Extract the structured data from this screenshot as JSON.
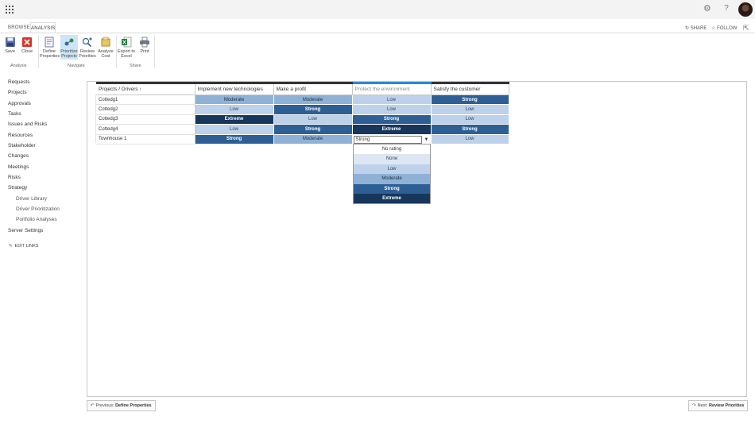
{
  "ribbon": {
    "tabs": {
      "browse": "BROWSE",
      "analysis": "ANALYSIS"
    },
    "actions": {
      "share": "SHARE",
      "follow": "FOLLOW"
    },
    "buttons": {
      "save": "Save",
      "close": "Close",
      "define_properties": [
        "Define",
        "Properties"
      ],
      "prioritize_projects": [
        "Prioritize",
        "Projects"
      ],
      "review_priorities": [
        "Review",
        "Priorities"
      ],
      "analyze_cost": [
        "Analyze",
        "Cost"
      ],
      "export_to_excel": [
        "Export to",
        "Excel"
      ],
      "print": "Print"
    },
    "groups": {
      "analysis": "Analysis",
      "navigate": "Navigate",
      "share": "Share"
    }
  },
  "nav": {
    "items": [
      "Requests",
      "Projects",
      "Approvals",
      "Tasks",
      "Issues and Risks",
      "Resources",
      "Stakeholder",
      "Changes",
      "Meetings",
      "Risks",
      "Strategy"
    ],
    "strategy_children": [
      "Driver Library",
      "Driver Prioritization",
      "Portfolio Analyses"
    ],
    "server_settings": "Server Settings",
    "edit_links": "EDIT LINKS"
  },
  "grid": {
    "headers": [
      "Projects / Drivers ↑",
      "Implement new technologies",
      "Make a profit",
      "Protect the environment",
      "Satisfy the customer"
    ],
    "rows": [
      {
        "project": "Cottedg1",
        "ratings": [
          "Moderate",
          "Moderate",
          "Low",
          "Strong"
        ]
      },
      {
        "project": "Cottedg2",
        "ratings": [
          "Low",
          "Strong",
          "Low",
          "Low"
        ]
      },
      {
        "project": "Cottedg3",
        "ratings": [
          "Extreme",
          "Low",
          "Strong",
          "Low"
        ]
      },
      {
        "project": "Cottedg4",
        "ratings": [
          "Low",
          "Strong",
          "Extreme",
          "Strong"
        ]
      },
      {
        "project": "Townhouse 1",
        "ratings": [
          "Strong",
          "Moderate",
          "Strong",
          "Low"
        ]
      }
    ],
    "editing_value": "Strong",
    "caret": "▼",
    "dropdown_options": [
      "No rating",
      "None",
      "Low",
      "Moderate",
      "Strong",
      "Extreme"
    ]
  },
  "footer": {
    "previous_prefix": "Previous:",
    "previous_target": "Define Properties",
    "next_prefix": "Next:",
    "next_target": "Review Priorities"
  },
  "colors": {
    "moderate": "#8fb1d6",
    "low": "#bed1ea",
    "strong": "#2d5f95",
    "extreme": "#17365c",
    "none": "#dde7f3",
    "accent": "#2b88d8"
  },
  "icons": [
    "app-launcher-icon",
    "gear-icon",
    "help-icon",
    "save-icon",
    "close-icon",
    "define-properties-icon",
    "prioritize-projects-icon",
    "review-priorities-icon",
    "analyze-cost-icon",
    "excel-icon",
    "print-icon",
    "share-icon",
    "follow-star-icon",
    "focus-icon",
    "pencil-icon"
  ]
}
